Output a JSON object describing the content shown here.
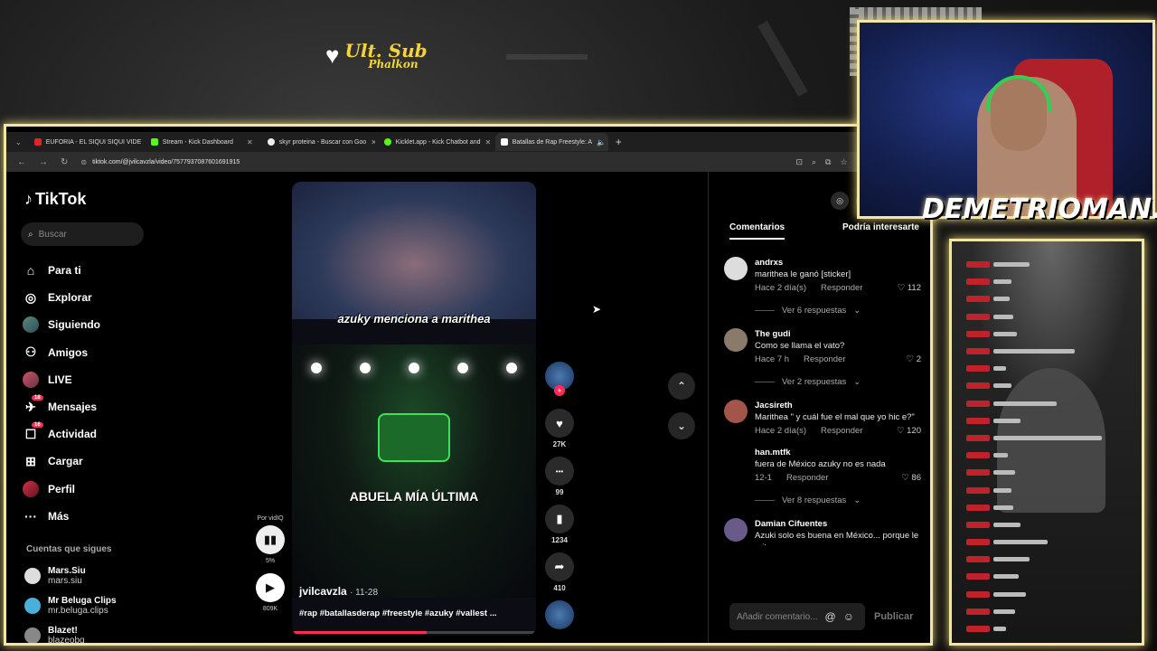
{
  "overlay": {
    "sub_line1": "Ult. Sub",
    "sub_line2": "Phalkon",
    "streamer": "DEMETRIOMAN..."
  },
  "browser": {
    "tabs": [
      {
        "label": "EUFORIA - EL SIQUI SIQUI VIDE",
        "color": "#e0242b",
        "active": false
      },
      {
        "label": "Stream - Kick Dashboard",
        "color": "#53fc18",
        "active": false
      },
      {
        "label": "skyr proteina - Buscar con Goo",
        "color": "#eeeeee",
        "active": false
      },
      {
        "label": "Kicklet.app - Kick Chatbot and",
        "color": "#53fc18",
        "active": false
      },
      {
        "label": "Batallas de Rap Freestyle: A",
        "color": "#ffffff",
        "active": true
      }
    ],
    "url": "tiktok.com/@jvilcavzla/video/7577937087601691915"
  },
  "tiktok": {
    "logo": "TikTok",
    "search_placeholder": "Buscar",
    "nav": [
      {
        "label": "Para ti",
        "icon": "home-icon",
        "glyph": "⌂",
        "badge": ""
      },
      {
        "label": "Explorar",
        "icon": "compass-icon",
        "glyph": "◎",
        "badge": ""
      },
      {
        "label": "Siguiendo",
        "icon": "following-avatar-icon",
        "glyph": "",
        "badge": ""
      },
      {
        "label": "Amigos",
        "icon": "friends-icon",
        "glyph": "⚇",
        "badge": ""
      },
      {
        "label": "LIVE",
        "icon": "live-avatar-icon",
        "glyph": "",
        "badge": ""
      },
      {
        "label": "Mensajes",
        "icon": "messages-icon",
        "glyph": "✈",
        "badge": "18"
      },
      {
        "label": "Actividad",
        "icon": "activity-icon",
        "glyph": "☐",
        "badge": "16"
      },
      {
        "label": "Cargar",
        "icon": "upload-icon",
        "glyph": "⊞",
        "badge": ""
      },
      {
        "label": "Perfil",
        "icon": "profile-avatar-icon",
        "glyph": "",
        "badge": ""
      },
      {
        "label": "Más",
        "icon": "more-icon",
        "glyph": "···",
        "badge": ""
      }
    ],
    "following_title": "Cuentas que sigues",
    "following": [
      {
        "name": "Mars.Siu",
        "handle": "mars.siu"
      },
      {
        "name": "Mr Beluga Clips",
        "handle": "mr.beluga.clips"
      },
      {
        "name": "Blazet!",
        "handle": "blazeobg"
      }
    ],
    "video": {
      "caption_top": "azuky menciona a marithea",
      "caption_mid": "ABUELA MÍA ÚLTIMA",
      "author": "jvilcavzla",
      "date": "· 11-28",
      "tags": "#rap #batallasderap #freestyle #azuky #vallest ...",
      "progress": 0.55
    },
    "vidiq": {
      "label": "Por vidIQ",
      "percent": "5%",
      "views": "809K"
    },
    "actions": [
      {
        "name": "like",
        "icon": "heart-icon",
        "glyph": "♥",
        "count": "27K"
      },
      {
        "name": "comment",
        "icon": "comment-icon",
        "glyph": "•••",
        "count": "99"
      },
      {
        "name": "save",
        "icon": "bookmark-icon",
        "glyph": "▮",
        "count": "1234"
      },
      {
        "name": "share",
        "icon": "share-icon",
        "glyph": "➦",
        "count": "410"
      }
    ],
    "comments_tab": "Comentarios",
    "suggest_tab": "Podría interesarte",
    "comments": [
      {
        "user": "andrxs",
        "text": "marithea le ganó [sticker]",
        "time": "Hace 2 día(s)",
        "reply": "Responder",
        "likes": "112",
        "more": "Ver 6 respuestas"
      },
      {
        "user": "The gudi",
        "text": "Como se llama el vato?",
        "time": "Hace 7 h",
        "reply": "Responder",
        "likes": "2",
        "more": "Ver 2 respuestas"
      },
      {
        "user": "Jacsireth",
        "text": "Marithea \" y cuál fue el mal que yo hic e?\"",
        "time": "Hace 2 día(s)",
        "reply": "Responder",
        "likes": "120",
        "more": ""
      },
      {
        "user": "han.mtfk",
        "text": "fuera de México azuky no es nada",
        "time": "12-1",
        "reply": "Responder",
        "likes": "86",
        "more": "Ver 8 respuestas"
      },
      {
        "user": "Damian Cifuentes",
        "text": "Azuki solo es buena en México... porque le gritan",
        "time": "",
        "reply": "",
        "likes": "",
        "more": ""
      }
    ],
    "comment_placeholder": "Añadir comentario...",
    "publish": "Publicar"
  }
}
